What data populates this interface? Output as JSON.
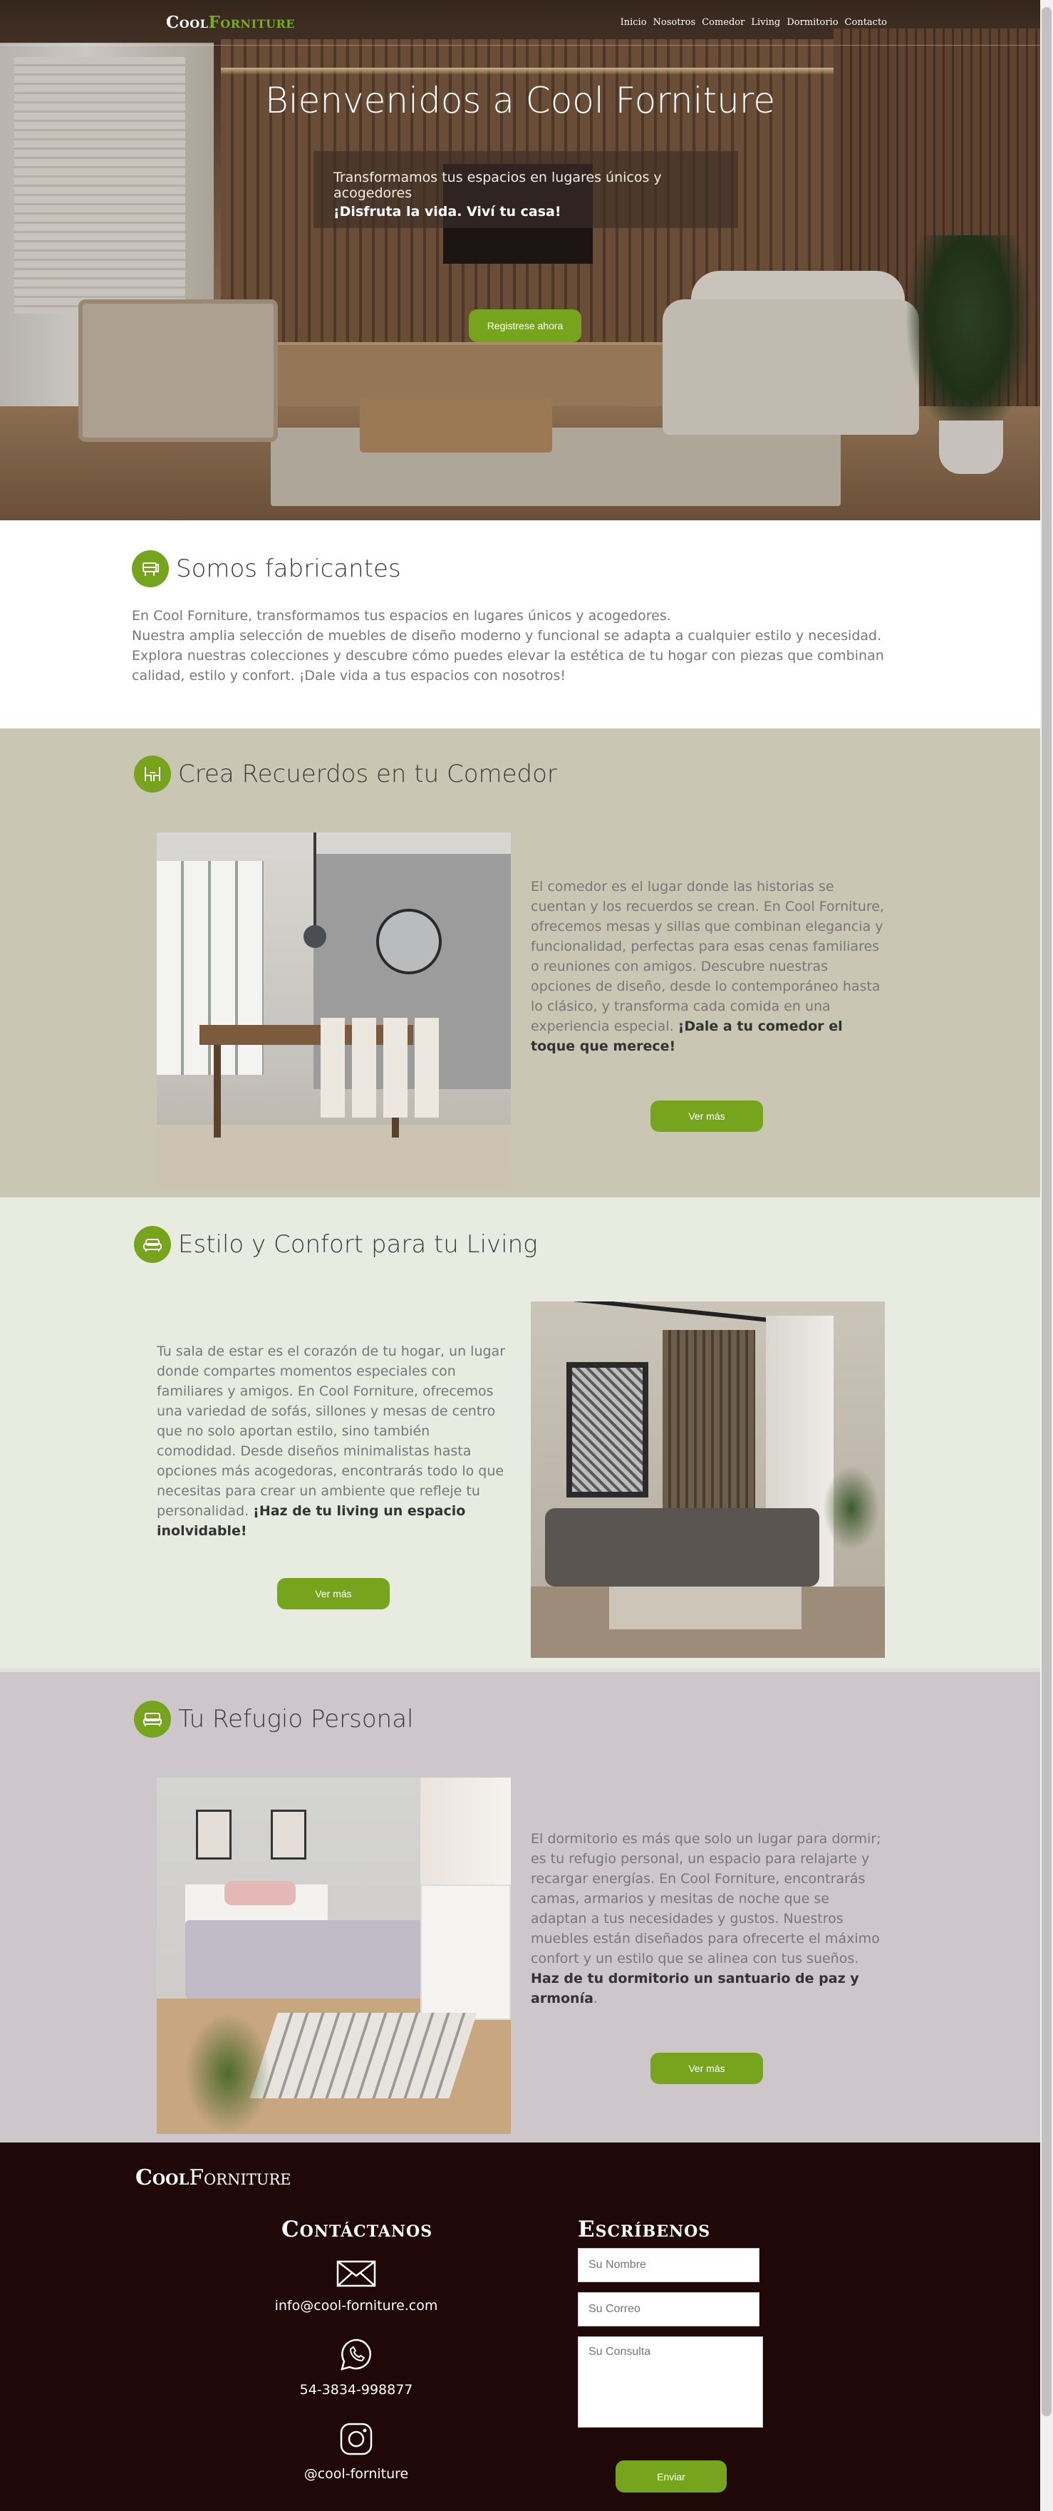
{
  "brand": {
    "part1": "Cool",
    "part2": "Forniture"
  },
  "nav": [
    "Inicio",
    "Nosotros",
    "Comedor",
    "Living",
    "Dormitorio",
    "Contacto"
  ],
  "hero": {
    "title": "Bienvenidos a Cool Forniture",
    "subtitle": "Transformamos tus espacios en lugares únicos y acogedores",
    "tagline": "¡Disfruta la vida. Viví tu casa!",
    "cta": "Registrese ahora"
  },
  "about": {
    "title": "Somos fabricantes",
    "line1": "En Cool Forniture, transformamos tus espacios en lugares únicos y acogedores.",
    "line2": "Nuestra amplia selección de muebles de diseño moderno y funcional se adapta a cualquier estilo y necesidad. Explora nuestras colecciones y descubre cómo puedes elevar la estética de tu hogar con piezas que combinan calidad, estilo y confort. ¡Dale vida a tus espacios con nosotros!"
  },
  "dining": {
    "title": "Crea Recuerdos en tu Comedor",
    "text": "El comedor es el lugar donde las historias se cuentan y los recuerdos se crean. En Cool Forniture, ofrecemos mesas y sillas que combinan elegancia y funcionalidad, perfectas para esas cenas familiares o reuniones con amigos. Descubre nuestras opciones de diseño, desde lo contemporáneo hasta lo clásico, y transforma cada comida en una experiencia especial. ",
    "bold": "¡Dale a tu comedor el toque que merece!",
    "button": "Ver más"
  },
  "living": {
    "title": "Estilo y Confort para tu Living",
    "text": "Tu sala de estar es el corazón de tu hogar, un lugar donde compartes momentos especiales con familiares y amigos. En Cool Forniture, ofrecemos una variedad de sofás, sillones y mesas de centro que no solo aportan estilo, sino también comodidad. Desde diseños minimalistas hasta opciones más acogedoras, encontrarás todo lo que necesitas para crear un ambiente que refleje tu personalidad. ",
    "bold": "¡Haz de tu living un espacio inolvidable!",
    "button": "Ver más"
  },
  "bedroom": {
    "title": "Tu Refugio Personal",
    "text": "El dormitorio es más que solo un lugar para dormir; es tu refugio personal, un espacio para relajarte y recargar energías. En Cool Forniture, encontrarás camas, armarios y mesitas de noche que se adaptan a tus necesidades y gustos. Nuestros muebles están diseñados para ofrecerte el máximo confort y un estilo que se alinea con tus sueños. ",
    "bold": "Haz de tu dormitorio un santuario de paz y armonía",
    "tail": ".",
    "button": "Ver más"
  },
  "footer": {
    "logo_part1": "Cool",
    "logo_part2": "Forniture",
    "contact_title": "Contáctanos",
    "email": "info@cool-forniture.com",
    "phone": "54-3834-998877",
    "instagram": "@cool-forniture",
    "write_title": "Escríbenos",
    "name_placeholder": "Su Nombre",
    "email_placeholder": "Su Correo",
    "query_placeholder": "Su Consulta",
    "send": "Enviar"
  },
  "colors": {
    "accent": "#76a41c",
    "footer_bg": "#200808",
    "dining_bg": "#c9c6b3",
    "living_bg": "#e8ebe0",
    "bedroom_bg": "#cdc6cb"
  }
}
